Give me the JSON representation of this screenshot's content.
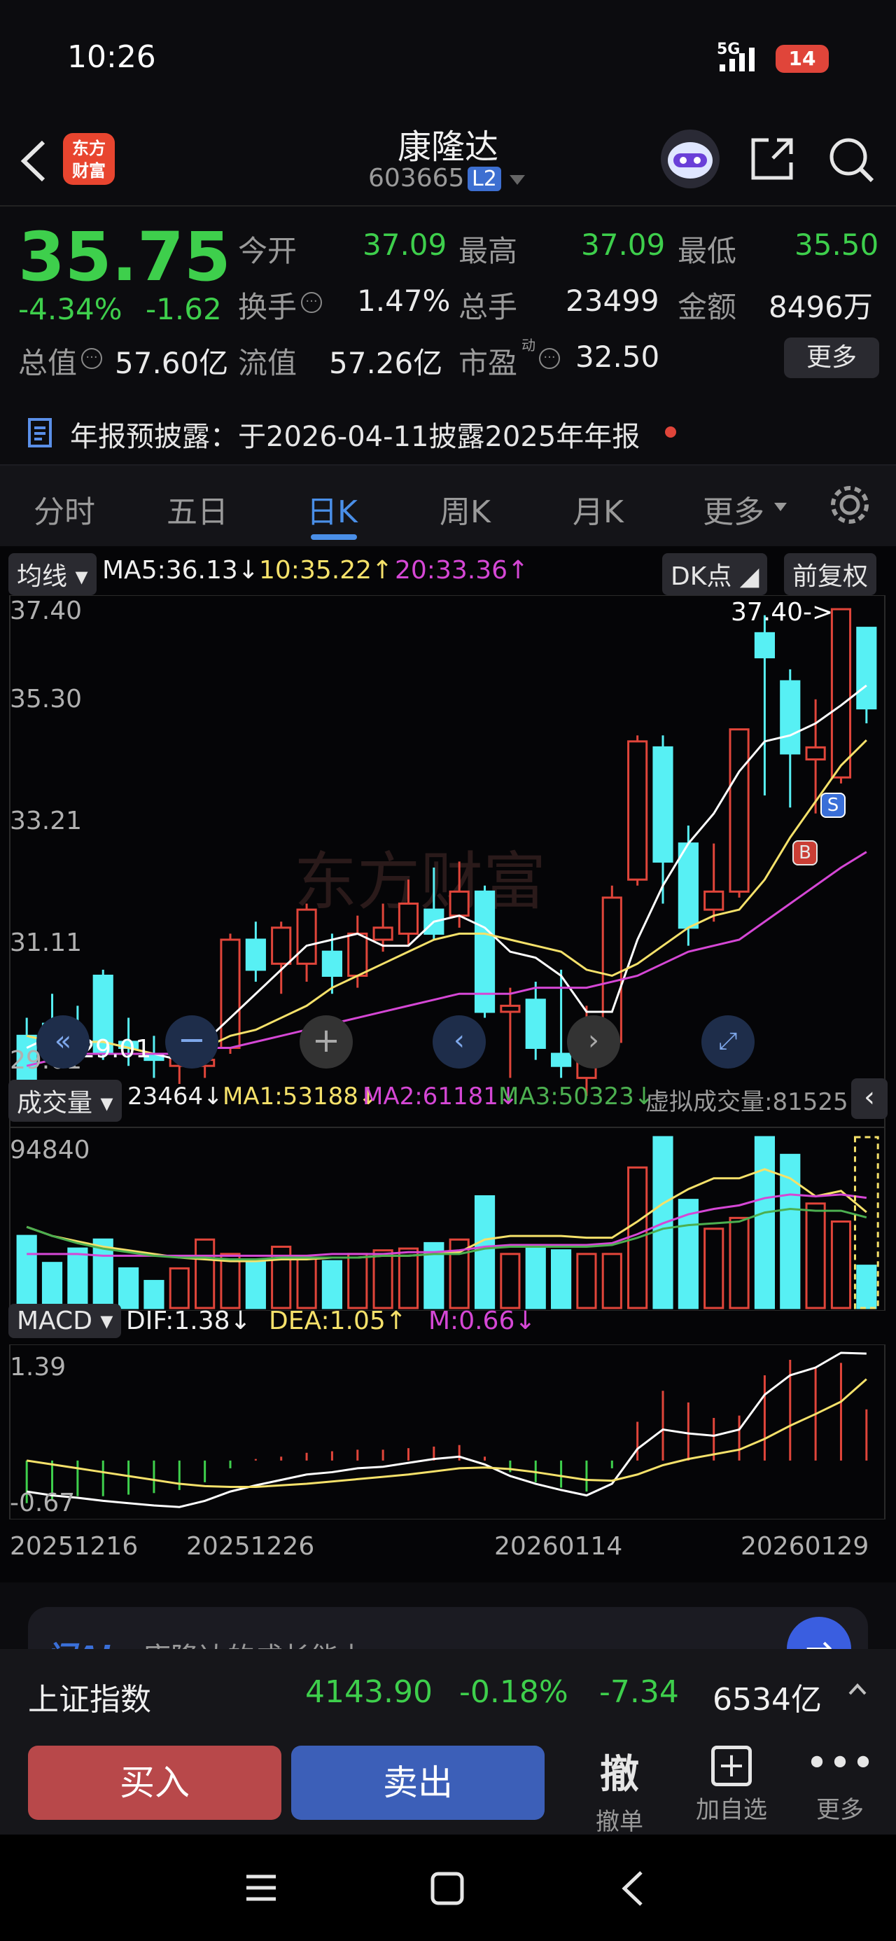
{
  "status_bar": {
    "time": "10:26",
    "network": "5G",
    "battery": "14"
  },
  "header": {
    "logo_line1": "东方",
    "logo_line2": "财富",
    "title": "康隆达",
    "code": "603665",
    "level": "L2"
  },
  "quote": {
    "price": "35.75",
    "change_pct": "-4.34%",
    "change": "-1.62",
    "stats": [
      {
        "label": "今开",
        "value": "37.09"
      },
      {
        "label": "最高",
        "value": "37.09"
      },
      {
        "label": "最低",
        "value": "35.50"
      },
      {
        "label": "换手",
        "value": "1.47%"
      },
      {
        "label": "总手",
        "value": "23499"
      },
      {
        "label": "金额",
        "value": "8496万"
      },
      {
        "label": "总值",
        "value": "57.60亿"
      },
      {
        "label": "流值",
        "value": "57.26亿"
      },
      {
        "label": "市盈",
        "value": "32.50"
      }
    ],
    "pe_sup": "动",
    "more": "更多"
  },
  "notice": {
    "text": "年报预披露：于2026-04-11披露2025年年报"
  },
  "tabs": [
    "分时",
    "五日",
    "日K",
    "周K",
    "月K",
    "更多"
  ],
  "chart": {
    "ma_menu": "均线",
    "ma5": "MA5:36.13",
    "ma10": "10:35.22",
    "ma20": "20:33.36",
    "dk": "DK点",
    "fq": "前复权",
    "price_axis": [
      "37.40",
      "35.30",
      "33.21",
      "31.11",
      "29.01"
    ],
    "high_marker": "37.40->",
    "low_marker": "<-29.01",
    "watermark": "东方财富",
    "buy_marker": "B",
    "sell_marker": "S",
    "vol_menu": "成交量",
    "vol": "23464",
    "vol_ma1": "MA1:53188",
    "vol_ma2": "MA2:61181",
    "vol_ma3": "MA3:50323",
    "vol_virtual": "虚拟成交量:81525",
    "vol_axis": "94840",
    "macd_menu": "MACD",
    "dif": "DIF:1.38",
    "dea": "DEA:1.05",
    "m": "M:0.66",
    "macd_top": "1.39",
    "macd_bottom": "-0.67",
    "dates": [
      "20251216",
      "20251226",
      "20260114",
      "20260129"
    ],
    "colors": {
      "up": "#e0453a",
      "down": "#57f0f4",
      "ma5": "#ffffff",
      "ma10": "#f5e16a",
      "ma20": "#d547d5",
      "ma3": "#4caf50"
    }
  },
  "chart_data": {
    "type": "candlestick",
    "candles": [
      {
        "o": 30.3,
        "c": 29.5,
        "h": 30.6,
        "l": 29.0
      },
      {
        "o": 30.5,
        "c": 30.4,
        "h": 31.0,
        "l": 30.1
      },
      {
        "o": 30.3,
        "c": 30.2,
        "h": 30.8,
        "l": 29.9
      },
      {
        "o": 31.3,
        "c": 30.0,
        "h": 31.4,
        "l": 29.9
      },
      {
        "o": 30.2,
        "c": 30.1,
        "h": 30.6,
        "l": 29.8
      },
      {
        "o": 30.0,
        "c": 29.9,
        "h": 30.3,
        "l": 29.6
      },
      {
        "o": 29.8,
        "c": 30.0,
        "h": 30.4,
        "l": 29.5
      },
      {
        "o": 29.8,
        "c": 29.9,
        "h": 30.3,
        "l": 29.6
      },
      {
        "o": 30.1,
        "c": 31.9,
        "h": 32.0,
        "l": 30.0
      },
      {
        "o": 31.9,
        "c": 31.4,
        "h": 32.2,
        "l": 31.2
      },
      {
        "o": 31.5,
        "c": 32.1,
        "h": 32.2,
        "l": 31.0
      },
      {
        "o": 31.5,
        "c": 32.4,
        "h": 32.5,
        "l": 31.2
      },
      {
        "o": 31.7,
        "c": 31.3,
        "h": 32.0,
        "l": 31.0
      },
      {
        "o": 31.3,
        "c": 32.0,
        "h": 32.3,
        "l": 31.1
      },
      {
        "o": 31.9,
        "c": 32.1,
        "h": 32.5,
        "l": 31.7
      },
      {
        "o": 32.0,
        "c": 32.5,
        "h": 32.9,
        "l": 31.8
      },
      {
        "o": 32.4,
        "c": 32.0,
        "h": 33.1,
        "l": 31.9
      },
      {
        "o": 32.3,
        "c": 32.7,
        "h": 33.2,
        "l": 32.1
      },
      {
        "o": 32.7,
        "c": 30.7,
        "h": 32.8,
        "l": 30.6
      },
      {
        "o": 30.7,
        "c": 30.8,
        "h": 31.1,
        "l": 29.6
      },
      {
        "o": 30.9,
        "c": 30.1,
        "h": 31.2,
        "l": 29.9
      },
      {
        "o": 30.0,
        "c": 29.8,
        "h": 31.4,
        "l": 29.6
      },
      {
        "o": 29.6,
        "c": 30.2,
        "h": 30.8,
        "l": 29.3
      },
      {
        "o": 30.2,
        "c": 32.6,
        "h": 32.8,
        "l": 29.9
      },
      {
        "o": 32.9,
        "c": 35.2,
        "h": 35.3,
        "l": 32.8
      },
      {
        "o": 35.1,
        "c": 33.2,
        "h": 35.3,
        "l": 32.5
      },
      {
        "o": 33.5,
        "c": 32.1,
        "h": 33.8,
        "l": 31.8
      },
      {
        "o": 32.4,
        "c": 32.7,
        "h": 33.5,
        "l": 32.2
      },
      {
        "o": 32.7,
        "c": 35.4,
        "h": 35.4,
        "l": 32.6
      },
      {
        "o": 37.0,
        "c": 36.6,
        "h": 37.3,
        "l": 34.3
      },
      {
        "o": 36.2,
        "c": 35.0,
        "h": 36.4,
        "l": 34.1
      },
      {
        "o": 34.9,
        "c": 35.1,
        "h": 35.9,
        "l": 34.0
      },
      {
        "o": 34.6,
        "c": 37.4,
        "h": 37.4,
        "l": 34.5
      },
      {
        "o": 37.09,
        "c": 35.75,
        "h": 37.09,
        "l": 35.5
      }
    ],
    "ma5": [
      30.1,
      30.3,
      30.2,
      30.2,
      30.1,
      30.0,
      29.9,
      30.2,
      30.6,
      31.0,
      31.4,
      31.8,
      31.9,
      32.0,
      31.8,
      31.8,
      32.2,
      32.3,
      32.1,
      31.7,
      31.6,
      31.3,
      30.7,
      30.7,
      31.9,
      32.8,
      33.5,
      34.0,
      34.7,
      35.2,
      35.3,
      35.5,
      35.8,
      36.13
    ],
    "ma10": [
      30.3,
      30.2,
      30.2,
      30.2,
      30.1,
      30.0,
      30.0,
      30.1,
      30.3,
      30.4,
      30.6,
      30.8,
      31.1,
      31.3,
      31.5,
      31.7,
      31.9,
      32.0,
      32.0,
      31.9,
      31.8,
      31.7,
      31.4,
      31.3,
      31.5,
      31.8,
      32.1,
      32.3,
      32.4,
      32.9,
      33.6,
      34.2,
      34.8,
      35.22
    ],
    "ma20": [
      29.8,
      29.9,
      30.0,
      30.0,
      30.0,
      30.0,
      30.0,
      30.1,
      30.1,
      30.2,
      30.3,
      30.4,
      30.5,
      30.6,
      30.7,
      30.8,
      30.9,
      31.0,
      31.0,
      31.0,
      31.1,
      31.1,
      31.1,
      31.2,
      31.3,
      31.5,
      31.7,
      31.8,
      31.9,
      32.2,
      32.5,
      32.8,
      33.1,
      33.36
    ],
    "volume": [
      40000,
      25000,
      33000,
      38000,
      22000,
      15000,
      22000,
      38000,
      30000,
      26000,
      34000,
      28000,
      26000,
      30000,
      32000,
      33000,
      36000,
      38000,
      62000,
      30000,
      34000,
      32000,
      30000,
      30000,
      78000,
      94840,
      60000,
      44000,
      50000,
      94840,
      85000,
      58000,
      48000,
      23464
    ],
    "vol_ma1": [
      45000,
      40000,
      37000,
      34000,
      32000,
      30000,
      28000,
      27000,
      26000,
      26000,
      27000,
      27000,
      28000,
      28000,
      29000,
      29000,
      30000,
      31000,
      38000,
      40000,
      40000,
      40000,
      39000,
      39000,
      48000,
      58000,
      66000,
      72000,
      72000,
      77000,
      72000,
      62000,
      65000,
      53188
    ],
    "vol_ma2": [
      30000,
      30000,
      30000,
      29000,
      29000,
      29000,
      29000,
      29000,
      29000,
      29000,
      29000,
      29000,
      30000,
      30000,
      30000,
      31000,
      31000,
      32000,
      34000,
      35000,
      35000,
      35000,
      35000,
      36000,
      41000,
      47000,
      52000,
      55000,
      57000,
      61000,
      63000,
      62000,
      63000,
      61181
    ],
    "vol_ma3": [
      45000,
      40000,
      36000,
      33000,
      31000,
      29000,
      28000,
      28000,
      27000,
      27000,
      28000,
      28000,
      28000,
      28000,
      29000,
      29000,
      30000,
      30000,
      33000,
      34000,
      34000,
      34000,
      34000,
      35000,
      39000,
      44000,
      46000,
      47000,
      48000,
      53000,
      55000,
      54000,
      54000,
      50323
    ],
    "dif": [
      -0.4,
      -0.45,
      -0.48,
      -0.52,
      -0.55,
      -0.58,
      -0.6,
      -0.52,
      -0.4,
      -0.32,
      -0.25,
      -0.18,
      -0.15,
      -0.1,
      -0.08,
      -0.03,
      0.02,
      0.05,
      -0.05,
      -0.2,
      -0.3,
      -0.38,
      -0.45,
      -0.3,
      0.15,
      0.4,
      0.35,
      0.32,
      0.4,
      0.85,
      1.1,
      1.2,
      1.39,
      1.38
    ],
    "dea": [
      0.0,
      -0.05,
      -0.1,
      -0.15,
      -0.2,
      -0.25,
      -0.3,
      -0.33,
      -0.34,
      -0.34,
      -0.32,
      -0.3,
      -0.27,
      -0.24,
      -0.21,
      -0.18,
      -0.14,
      -0.1,
      -0.09,
      -0.11,
      -0.15,
      -0.2,
      -0.25,
      -0.26,
      -0.18,
      -0.06,
      0.02,
      0.08,
      0.14,
      0.28,
      0.45,
      0.6,
      0.76,
      1.05
    ],
    "macd": [
      -0.55,
      -0.5,
      -0.46,
      -0.46,
      -0.44,
      -0.42,
      -0.38,
      -0.28,
      -0.1,
      0.02,
      0.05,
      0.1,
      0.12,
      0.14,
      0.14,
      0.16,
      0.18,
      0.2,
      0.05,
      -0.15,
      -0.28,
      -0.35,
      -0.4,
      -0.1,
      0.5,
      0.9,
      0.75,
      0.55,
      0.58,
      1.1,
      1.3,
      1.2,
      1.26,
      0.66
    ],
    "price_range": [
      29.01,
      37.4
    ],
    "macd_range": [
      -0.67,
      1.39
    ],
    "vol_max": 94840
  },
  "ai_bar": {
    "brand": "问Ai",
    "question": "康隆达的成长能力"
  },
  "index": {
    "name": "上证指数",
    "value": "4143.90",
    "pct": "-0.18%",
    "change": "-7.34",
    "amount": "6534亿"
  },
  "actions": {
    "buy": "买入",
    "sell": "卖出",
    "cancel_icon": "撤",
    "cancel": "撤单",
    "watch": "加自选",
    "more": "更多"
  }
}
